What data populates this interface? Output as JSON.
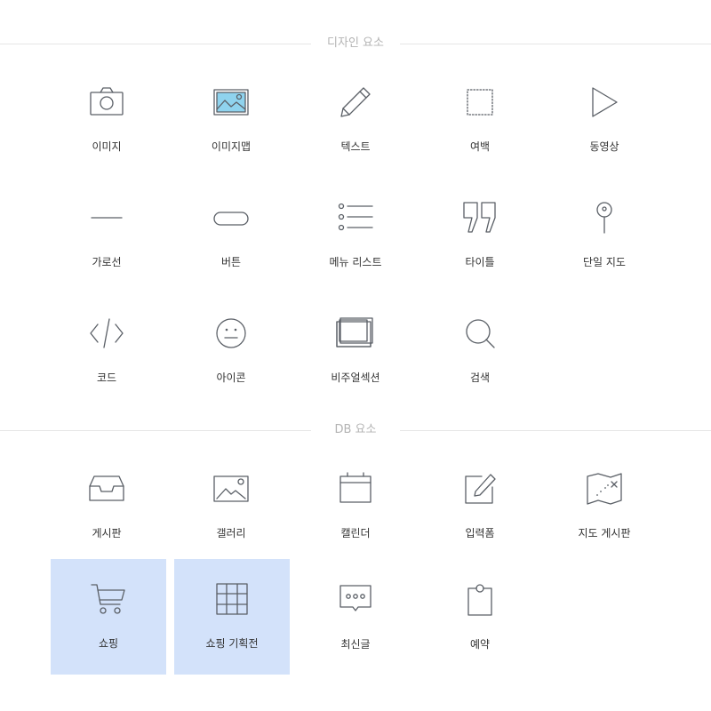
{
  "sections": {
    "design": {
      "title": "디자인 요소",
      "items": [
        {
          "label": "이미지",
          "icon": "camera-icon"
        },
        {
          "label": "이미지맵",
          "icon": "image-map-icon"
        },
        {
          "label": "텍스트",
          "icon": "pencil-icon"
        },
        {
          "label": "여백",
          "icon": "dotted-square-icon"
        },
        {
          "label": "동영상",
          "icon": "play-icon"
        },
        {
          "label": "가로선",
          "icon": "horizontal-line-icon"
        },
        {
          "label": "버튼",
          "icon": "button-icon"
        },
        {
          "label": "메뉴 리스트",
          "icon": "list-icon"
        },
        {
          "label": "타이틀",
          "icon": "quote-icon"
        },
        {
          "label": "단일 지도",
          "icon": "map-pin-icon"
        },
        {
          "label": "코드",
          "icon": "code-icon"
        },
        {
          "label": "아이콘",
          "icon": "face-icon"
        },
        {
          "label": "비주얼섹션",
          "icon": "layers-icon"
        },
        {
          "label": "검색",
          "icon": "search-icon"
        }
      ]
    },
    "db": {
      "title": "DB 요소",
      "items": [
        {
          "label": "게시판",
          "icon": "inbox-icon"
        },
        {
          "label": "갤러리",
          "icon": "gallery-icon"
        },
        {
          "label": "캘린더",
          "icon": "calendar-icon"
        },
        {
          "label": "입력폼",
          "icon": "edit-form-icon"
        },
        {
          "label": "지도 게시판",
          "icon": "map-board-icon"
        },
        {
          "label": "쇼핑",
          "icon": "cart-icon",
          "selected": true
        },
        {
          "label": "쇼핑 기획전",
          "icon": "grid-icon",
          "selected": true
        },
        {
          "label": "최신글",
          "icon": "chat-bubble-icon"
        },
        {
          "label": "예약",
          "icon": "clipboard-icon"
        }
      ]
    }
  },
  "colors": {
    "selected_bg": "#d3e2fa",
    "icon_stroke": "#5a5f66",
    "section_title": "#b3b3b3",
    "label": "#333333",
    "image_fill": "#8fd3ee"
  }
}
